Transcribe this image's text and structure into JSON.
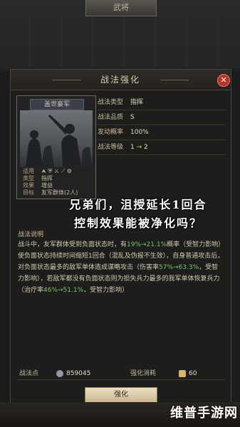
{
  "top_tab": "武将",
  "panel": {
    "title": "战法强化",
    "close_icon": "close-icon"
  },
  "card": {
    "name": "盖世豪军",
    "info": [
      {
        "k": "适用",
        "v": ""
      },
      {
        "k": "类型",
        "v": "指挥"
      },
      {
        "k": "效果",
        "v": "增益"
      },
      {
        "k": "目标",
        "v": "友军群体(2人)"
      }
    ]
  },
  "stats": [
    {
      "k": "战法类型",
      "v": "指挥"
    },
    {
      "k": "战法品质",
      "v": "S"
    },
    {
      "k": "发动概率",
      "v": "100%"
    },
    {
      "k": "战法等级",
      "v": "1",
      "arrow": "→",
      "v2": "2"
    }
  ],
  "caption": {
    "line1": "兄弟们，沮授延长1回合",
    "line2": "控制效果能被净化吗？"
  },
  "description": {
    "title": "战法说明",
    "segments": [
      {
        "t": "战斗中，友军群体受到负面状态时，有",
        "c": ""
      },
      {
        "t": "19%→21.1%",
        "c": "green"
      },
      {
        "t": "概率（受智力影响）使负面状态持续时间缩短1回合（混乱及伪报不生效），自身普通攻击后，对负面状态最多的敌军单体造成谋略攻击（伤害率",
        "c": ""
      },
      {
        "t": "57%→63.3%",
        "c": "green"
      },
      {
        "t": "，受智力影响），若敌军都没有负面状态则为损失兵力最多的我军单体恢复兵力（治疗率",
        "c": ""
      },
      {
        "t": "46%→51.1%",
        "c": "green"
      },
      {
        "t": "，受智力影响）",
        "c": ""
      }
    ]
  },
  "bottom": {
    "points_label": "战法点",
    "points_value": "859045",
    "cost_label": "强化消耗",
    "cost_value": "60"
  },
  "enhance_button": "强化",
  "watermark": "维普手游网"
}
